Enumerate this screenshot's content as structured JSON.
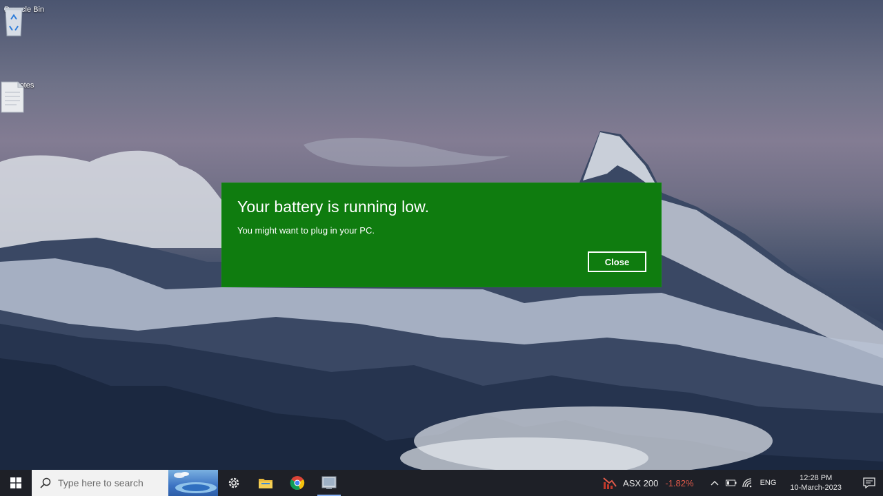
{
  "desktop": {
    "icons": [
      {
        "label": "Recycle Bin",
        "icon": "recycle-bin-icon"
      },
      {
        "label": "Notes",
        "icon": "text-document-icon"
      }
    ]
  },
  "toast": {
    "title": "Your battery is running low.",
    "message": "You might want to plug in your PC.",
    "close_label": "Close",
    "background_color": "#0f7c0f"
  },
  "taskbar": {
    "search_placeholder": "Type here to search",
    "apps": [
      {
        "name": "Settings",
        "icon": "gear-icon"
      },
      {
        "name": "File Explorer",
        "icon": "folder-icon"
      },
      {
        "name": "Google Chrome",
        "icon": "chrome-icon"
      },
      {
        "name": "Window app",
        "icon": "window-app-icon"
      }
    ],
    "ticker": {
      "name": "ASX 200",
      "change": "-1.82%",
      "change_color": "#e05a4a"
    },
    "language": "ENG",
    "clock": {
      "time": "12:28 PM",
      "date": "10-March-2023"
    }
  }
}
